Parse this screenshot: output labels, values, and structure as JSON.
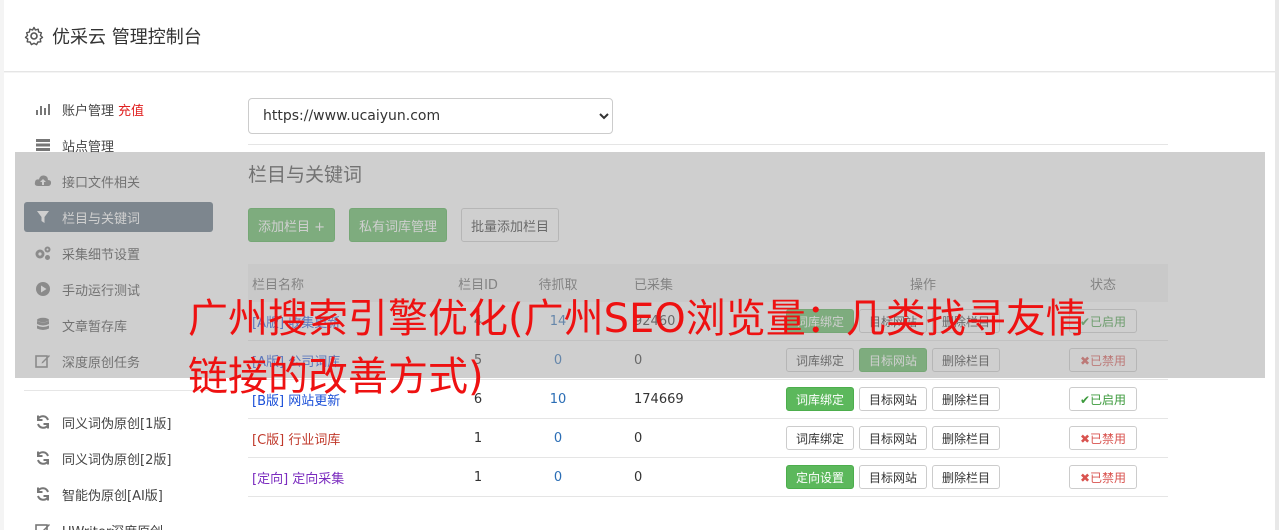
{
  "header": {
    "title": "优采云 管理控制台"
  },
  "sidebar": {
    "group1": [
      {
        "label": "账户管理",
        "extra": "充值",
        "icon": "bar-chart-icon"
      },
      {
        "label": "站点管理",
        "icon": "server-icon"
      },
      {
        "label": "接口文件相关",
        "icon": "cloud-upload-icon"
      },
      {
        "label": "栏目与关键词",
        "icon": "filter-icon",
        "active": true
      },
      {
        "label": "采集细节设置",
        "icon": "cogs-icon"
      },
      {
        "label": "手动运行测试",
        "icon": "play-circle-icon"
      },
      {
        "label": "文章暂存库",
        "icon": "database-icon"
      },
      {
        "label": "深度原创任务",
        "icon": "edit-icon"
      }
    ],
    "group2": [
      {
        "label": "同义词伪原创[1版]",
        "icon": "refresh-icon"
      },
      {
        "label": "同义词伪原创[2版]",
        "icon": "refresh-icon"
      },
      {
        "label": "智能伪原创[AI版]",
        "icon": "refresh-icon"
      },
      {
        "label": "UWriter深度原创",
        "icon": "edit-icon"
      }
    ]
  },
  "site_select": {
    "value": "https://www.ucaiyun.com"
  },
  "section": {
    "title": "栏目与关键词"
  },
  "buttons": {
    "add": "添加栏目 +",
    "private": "私有词库管理",
    "batch": "批量添加栏目"
  },
  "table": {
    "headers": {
      "name": "栏目名称",
      "id": "栏目ID",
      "wait": "待抓取",
      "got": "已采集",
      "ops": "操作",
      "state": "状态"
    },
    "rows": [
      {
        "tag": "[A版]",
        "name": "收集更新",
        "id": "4",
        "wait": "14",
        "got": "92460",
        "op1": "词库绑定",
        "op2": "目标网站",
        "op3": "删除栏目",
        "state": "✔已启用",
        "on": true
      },
      {
        "tag": "[A版]",
        "name": "公司词库",
        "id": "5",
        "wait": "0",
        "got": "0",
        "op1": "词库绑定",
        "op2": "目标网站",
        "op3": "删除栏目",
        "state": "✖已禁用",
        "on": false
      },
      {
        "tag": "[B版]",
        "name": "网站更新",
        "id": "6",
        "wait": "10",
        "got": "174669",
        "op1": "词库绑定",
        "op2": "目标网站",
        "op3": "删除栏目",
        "state": "✔已启用",
        "on": true
      },
      {
        "tag": "[C版]",
        "name": "行业词库",
        "id": "1",
        "wait": "0",
        "got": "0",
        "op1": "词库绑定",
        "op2": "目标网站",
        "op3": "删除栏目",
        "state": "✖已禁用",
        "on": false
      },
      {
        "tag": "[定向]",
        "name": "定向采集",
        "id": "1",
        "wait": "0",
        "got": "0",
        "op1": "定向设置",
        "op2": "目标网站",
        "op3": "删除栏目",
        "state": "✖已禁用",
        "on": false
      }
    ]
  },
  "overlay_text": "广州搜索引擎优化(广州SEO浏览量：几类找寻友情链接的改善方式)"
}
